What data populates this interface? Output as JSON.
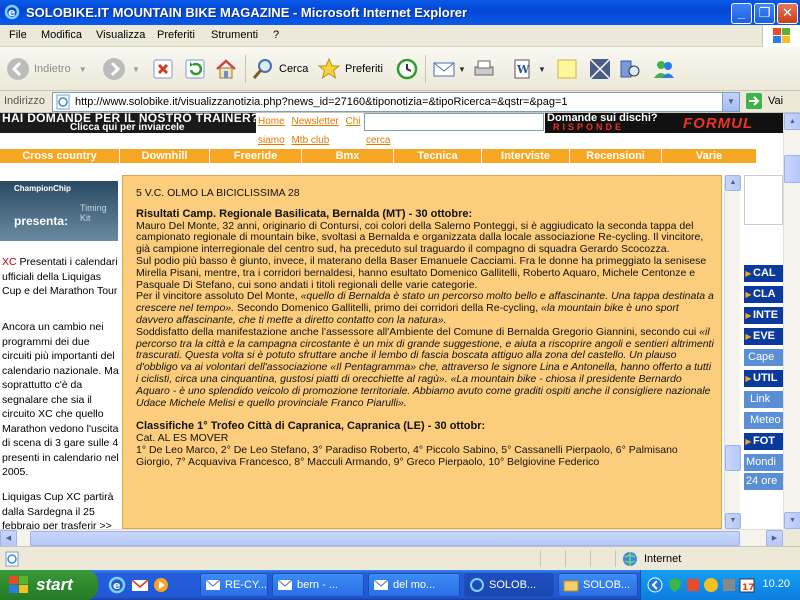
{
  "window": {
    "title": "SOLOBIKE.IT MOUNTAIN BIKE MAGAZINE - Microsoft Internet Explorer"
  },
  "menu": [
    "File",
    "Modifica",
    "Visualizza",
    "Preferiti",
    "Strumenti",
    "?"
  ],
  "toolbar": {
    "back_label": "Indietro",
    "search_label": "Cerca",
    "favorites_label": "Preferiti"
  },
  "address": {
    "label": "Indirizzo",
    "url": "http://www.solobike.it/visualizzanotizia.php?news_id=27160&tiponotizia=&tipoRicerca=&qstr=&pag=1",
    "go_label": "Vai"
  },
  "page": {
    "banner_line1": "HAI DOMANDE PER IL NOSTRO TRAINER?",
    "banner_line2": "Clicca qui per inviarcele",
    "top_links": [
      "Home",
      "Newsletter",
      "Chi"
    ],
    "sub_links": [
      "siamo",
      "Mtb club"
    ],
    "sub_link_cerca": "cerca",
    "formula_question": "Domande sui dischi?",
    "formula_risponde": "RISPONDE",
    "formula_logo": "FORMUL",
    "nav": [
      "Cross country",
      "Downhill",
      "Freeride",
      "Bmx",
      "Tecnica",
      "Interviste",
      "Recensioni",
      "Varie"
    ],
    "champ": {
      "brand": "ChampionChip",
      "presenta": "presenta:",
      "side": "Timing Kit"
    },
    "left_news": [
      {
        "prefix": "XC",
        "text": "Presentati i calendari ufficiali della Liquigas Cup e del Marathon Tour"
      },
      {
        "prefix": "",
        "text": "Ancora un cambio nei programmi dei due circuiti più importanti del calendario nazionale. Ma soprattutto c'è da segnalare che sia il circuito XC che quello Marathon vedono l'uscita di scena di 3 gare sulle 4 presenti in calendario nel 2005."
      },
      {
        "prefix": "",
        "text": "Liquigas Cup XC partirà dalla Sardegna il 25 febbraio per trasferir >>"
      }
    ],
    "right_menu": [
      "CAL",
      "CLA",
      "INTE",
      "EVE",
      "Cape",
      "UTIL",
      "Link",
      "Meteo",
      "FOT",
      "Mondi",
      "24 ore"
    ],
    "article": {
      "line0": "5 V.C. OLMO LA BICICLISSIMA 28",
      "h1": "Risultati Camp. Regionale Basilicata, Bernalda (MT) - 30 ottobre:",
      "p1": "Mauro Del Monte, 32 anni, originario di Contursi, coi colori della Salerno Ponteggi, si è aggiudicato la seconda tappa del campionato regionale di mountain bike, svoltasi a Bernalda e organizzata dalla locale associazione Re-cycling. Il vincitore, già campione interregionale del centro sud, ha preceduto sul traguardo il compagno di squadra Gerardo Scocozza.",
      "p2": "Sul podio più basso è giunto, invece, il materano della Baser Emanuele Cacciami. Fra le donne ha primeggiato la senisese Mirella Pisani, mentre, tra i corridori bernaldesi, hanno esultato Domenico Gallitelli, Roberto Aquaro, Michele Centonze e Pasquale Di Stefano, cui sono andati i titoli regionali delle varie categorie.",
      "p3a": "Per il vincitore assoluto Del Monte, ",
      "p3b": "«quello di Bernalda è stato un percorso molto bello e affascinante. Una tappa destinata a crescere nel tempo».",
      "p3c": " Secondo Domenico Gallitelli, primo dei corridori della Re-cycling, ",
      "p3d": "«la mountain bike è uno sport davvero affascinante, che ti mette a diretto contatto con la natura».",
      "p4a": "Soddisfatto della manifestazione anche l'assessore all'Ambiente del Comune di Bernalda Gregorio Giannini, secondo cui ",
      "p4b": "«il percorso tra la città e la campagna circostante è un mix di grande suggestione, e aiuta a riscoprire angoli e sentieri altrimenti trascurati. Questa volta si è potuto sfruttare anche il lembo di fascia boscata attiguo alla zona del castello. Un plauso d'obbligo va ai volontari dell'associazione «Il Pentagramma» che, attraverso le signore Lina e Antonella, hanno offerto a tutti i ciclisti, circa una cinquantina, gustosi piatti di orecchiette al ragù». «La mountain bike - chiosa il presidente Bernardo Aquaro - è uno splendido veicolo di promozione territoriale. Abbiamo avuto come graditi ospiti anche il consigliere nazionale Udace Michele Melisi e quello provinciale Franco Piarulli».",
      "h2": "Classifiche 1° Trofeo Città di Capranica, Capranica (LE) - 30 ottobr:",
      "cat": "Cat. AL ES MOVER",
      "ranking": "1° De Leo Marco, 2° De Leo Stefano, 3° Paradiso Roberto, 4° Piccolo Sabino, 5° Cassanelli Pierpaolo, 6° Palmisano Giorgio, 7° Acquaviva Francesco, 8° Macculi Armando, 9° Greco Pierpaolo, 10° Belgiovine Federico"
    }
  },
  "status": {
    "zone": "Internet"
  },
  "taskbar": {
    "start_label": "start",
    "tasks": [
      "RE-CY...",
      "bern - ...",
      "del mo...",
      "SOLOB...",
      "SOLOB..."
    ],
    "clock": "10.20"
  },
  "colors": {
    "nav_orange": "#f5a623",
    "article_bg": "#fdcd7e",
    "link_orange": "#e07b00",
    "right_menu_blue": "#0a3a9e"
  }
}
